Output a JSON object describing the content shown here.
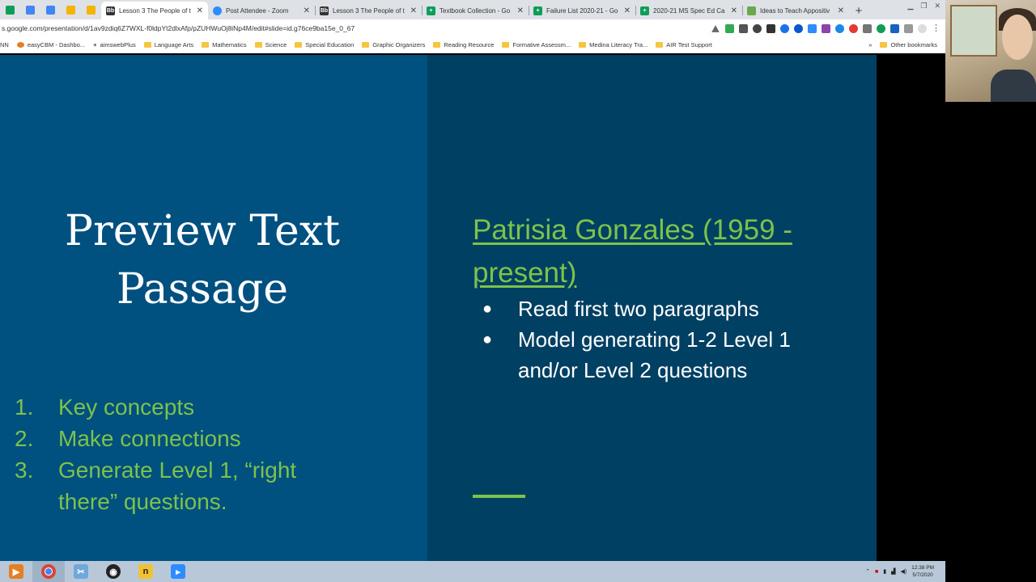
{
  "browser": {
    "tabs": [
      {
        "label": "Lesson 3 The People of t",
        "icon": "Bb",
        "color": "#333333",
        "active": true
      },
      {
        "label": "Post Attendee - Zoom",
        "icon": "zoom-icon",
        "color": "#2d8cff"
      },
      {
        "label": "Lesson 3 The People of t",
        "icon": "Bb",
        "color": "#333333"
      },
      {
        "label": "Textbook Collection - Go",
        "icon": "sheets-icon",
        "color": "#0f9d58"
      },
      {
        "label": "Failure List 2020-21 - Go",
        "icon": "sheets-icon",
        "color": "#0f9d58"
      },
      {
        "label": "2020-21 MS Spec Ed Ca",
        "icon": "sheets-icon",
        "color": "#0f9d58"
      },
      {
        "label": "Ideas to Teach Appositiv",
        "icon": "doc-icon",
        "color": "#6aa84f"
      }
    ],
    "url": "s.google.com/presentation/d/1av9zdiq6Z7WXL-f0ldpYt2dlxAfp/pZUHWuOj8iNp4M/edit#slide=id.g76ce9ba15e_0_67",
    "bookmarks": [
      "easyCBM - Dashbo...",
      "aimswebPlus",
      "Language Arts",
      "Mathematics",
      "Science",
      "Special Education",
      "Graphic Organizers",
      "Reading Resource",
      "Formative Assessm...",
      "Medina Literacy Tra...",
      "AIR Test Support"
    ],
    "other_bookmarks": "Other bookmarks",
    "bookmark_prefix": "NN",
    "overflow": "»",
    "new_tab": "+"
  },
  "slide": {
    "title": "Preview Text Passage",
    "numbered_list": [
      {
        "num": "1.",
        "text": "Key concepts"
      },
      {
        "num": "2.",
        "text": "Make connections"
      },
      {
        "num": "3.",
        "text": "Generate Level 1, “right there” questions."
      }
    ],
    "right_title": "Patrisia Gonzales (1959 - present)",
    "bullets": [
      "Read first two paragraphs",
      "Model generating 1-2 Level 1 and/or Level 2 questions"
    ],
    "colors": {
      "left_bg": "#005080",
      "right_bg": "#004063",
      "accent": "#7cc34a"
    }
  },
  "taskbar": {
    "apps": [
      "media-player-icon",
      "chrome-icon",
      "snipping-tool-icon",
      "obs-icon",
      "notes-icon",
      "zoom-icon"
    ],
    "time": "12:38 PM",
    "date": "5/7/2020"
  }
}
